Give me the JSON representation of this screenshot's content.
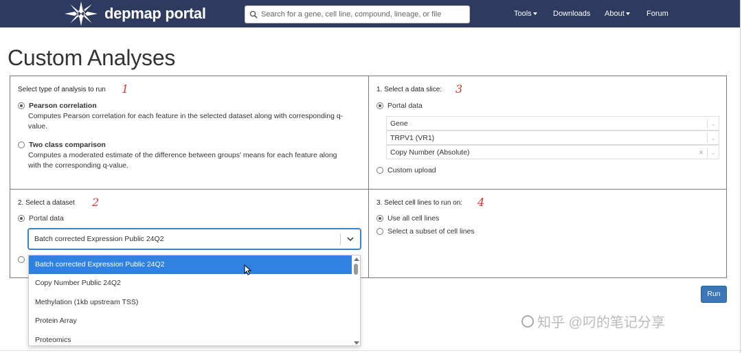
{
  "brand": {
    "logo_text": "depmap portal"
  },
  "search": {
    "placeholder": "Search for a gene, cell line, compound, lineage, or file"
  },
  "nav": {
    "tools": "Tools",
    "downloads": "Downloads",
    "about": "About",
    "forum": "Forum"
  },
  "page": {
    "title": "Custom Analyses"
  },
  "analysis_type": {
    "title": "Select type of analysis to run",
    "annotation": "1",
    "options": [
      {
        "label": "Pearson correlation",
        "desc": "Computes Pearson correlation for each feature in the selected dataset along with corresponding q-value.",
        "selected": true
      },
      {
        "label": "Two class comparison",
        "desc": "Computes a moderated estimate of the difference between groups' means for each feature along with the corresponding q-value.",
        "selected": false
      }
    ]
  },
  "data_slice": {
    "title": "1. Select a data slice:",
    "annotation": "3",
    "portal_label": "Portal data",
    "fields": [
      "Gene",
      "TRPV1 (VR1)",
      "Copy Number (Absolute)"
    ],
    "custom_label": "Custom upload"
  },
  "dataset": {
    "title": "2. Select a dataset",
    "annotation": "2",
    "portal_label": "Portal data",
    "selected": "Batch corrected Expression Public 24Q2",
    "options": [
      "Batch corrected Expression Public 24Q2",
      "Copy Number Public 24Q2",
      "Methylation (1kb upstream TSS)",
      "Protein Array",
      "Proteomics"
    ]
  },
  "cell_lines": {
    "title": "3. Select cell lines to run on:",
    "annotation": "4",
    "options": [
      "Use all cell lines",
      "Select a subset of cell lines"
    ]
  },
  "run_button": "Run",
  "watermark": "知乎 @叼的笔记分享",
  "colors": {
    "navbar": "#2e3a60",
    "selected_option": "#2f82e0",
    "run_button": "#3a76b8",
    "annotation": "#d9342b"
  }
}
